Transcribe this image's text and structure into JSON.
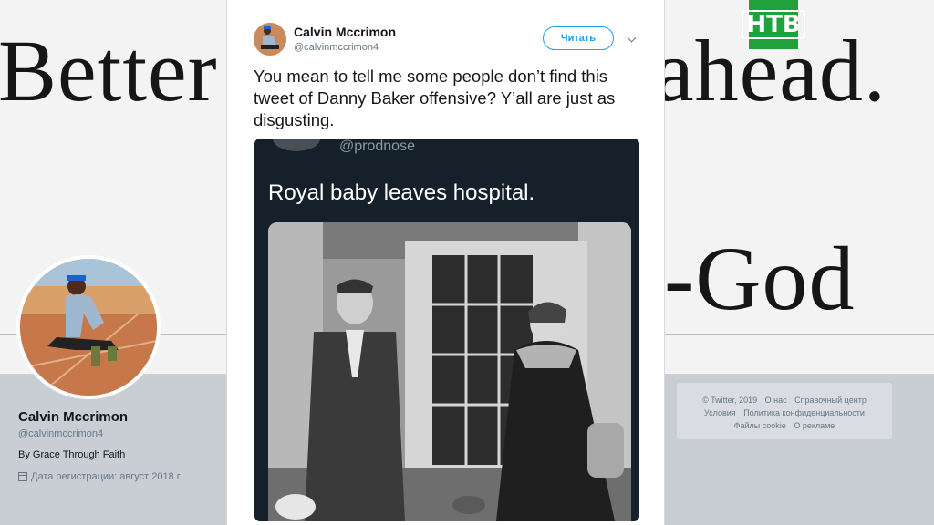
{
  "background": {
    "banner_words_left": "Better",
    "banner_words_right": "ahead.",
    "banner_line2": "-God",
    "profile": {
      "name": "Calvin Mccrimon",
      "handle": "@calvinmccrimon4",
      "bio": "By Grace Through Faith",
      "joined": "Дата регистрации: август 2018 г."
    },
    "footer_links": [
      "© Twitter, 2019",
      "О нас",
      "Справочный центр",
      "Условия",
      "Политика конфиденциальности",
      "Файлы cookie",
      "О рекламе"
    ]
  },
  "channel_logo": "НТВ",
  "tweet": {
    "author_name": "Calvin Mccrimon",
    "author_handle": "@calvinmccrimon4",
    "follow_label": "Читать",
    "text": "You mean to tell me some people don’t find this tweet of Danny Baker offensive? Y’all are just as disgusting.",
    "embedded": {
      "handle": "@prodnose",
      "text": "Royal baby leaves hospital."
    }
  },
  "icons": [
    "chevron-down-icon",
    "calendar-icon"
  ],
  "colors": {
    "accent": "#1da1f2",
    "ntv_green": "#1fa23b",
    "embed_bg": "#15202b"
  }
}
